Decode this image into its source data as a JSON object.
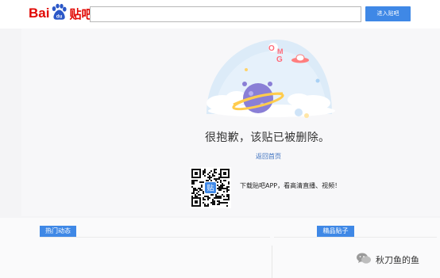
{
  "header": {
    "logo_text_bai": "Bai",
    "logo_text_du": "du",
    "logo_text_tieba": "贴吧",
    "search_placeholder": "",
    "search_button_label": "进入贴吧"
  },
  "error": {
    "illustration_text": "OMG",
    "message": "很抱歉，该贴已被删除。",
    "back_link": "返回首页",
    "qr_center_label": "贴",
    "app_promo": "下载贴吧APP，看高清直播、视频！"
  },
  "bottom": {
    "hot_tab": "热门动态",
    "featured_tab": "精品贴子"
  },
  "watermark": {
    "text": "秋刀鱼的鱼"
  },
  "colors": {
    "brand_red": "#e10601",
    "primary_blue": "#3f88e6",
    "link_blue": "#3a6fbf",
    "planet_purple": "#8a7fd6"
  }
}
